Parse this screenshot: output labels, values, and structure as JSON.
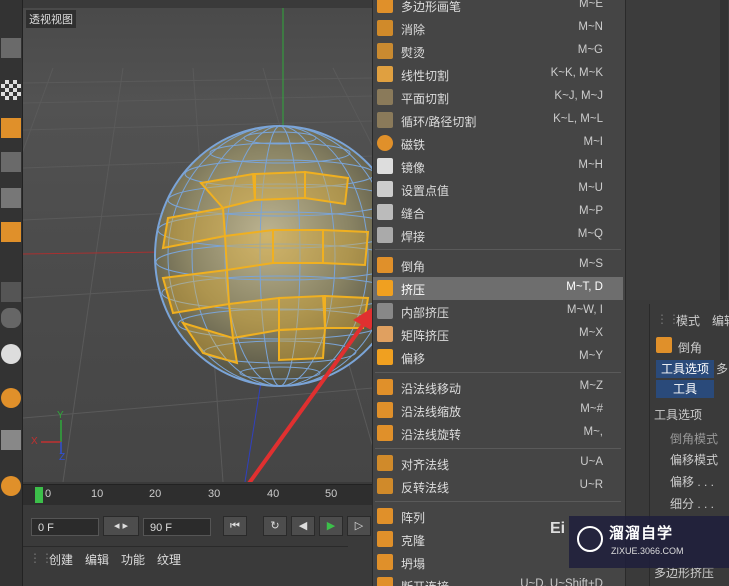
{
  "viewport": {
    "label": "透视视图"
  },
  "timeline": {
    "ticks": [
      "0",
      "10",
      "20",
      "30",
      "40",
      "50"
    ]
  },
  "transport": {
    "current_frame": "0 F",
    "end_frame": "90 F"
  },
  "bottom_menu": {
    "items": [
      "创建",
      "编辑",
      "功能",
      "纹理"
    ]
  },
  "menu": {
    "items": [
      {
        "label": "多边形画笔",
        "shortcut": "M~E"
      },
      {
        "label": "消除",
        "shortcut": "M~N"
      },
      {
        "label": "熨烫",
        "shortcut": "M~G"
      },
      {
        "label": "线性切割",
        "shortcut": "K~K, M~K"
      },
      {
        "label": "平面切割",
        "shortcut": "K~J, M~J"
      },
      {
        "label": "循环/路径切割",
        "shortcut": "K~L, M~L"
      },
      {
        "label": "磁铁",
        "shortcut": "M~I"
      },
      {
        "label": "镜像",
        "shortcut": "M~H"
      },
      {
        "label": "设置点值",
        "shortcut": "M~U"
      },
      {
        "label": "缝合",
        "shortcut": "M~P"
      },
      {
        "label": "焊接",
        "shortcut": "M~Q"
      },
      {
        "label": "倒角",
        "shortcut": "M~S"
      },
      {
        "label": "挤压",
        "shortcut": "M~T, D"
      },
      {
        "label": "内部挤压",
        "shortcut": "M~W, I"
      },
      {
        "label": "矩阵挤压",
        "shortcut": "M~X"
      },
      {
        "label": "偏移",
        "shortcut": "M~Y"
      },
      {
        "label": "沿法线移动",
        "shortcut": "M~Z"
      },
      {
        "label": "沿法线缩放",
        "shortcut": "M~#"
      },
      {
        "label": "沿法线旋转",
        "shortcut": "M~,"
      },
      {
        "label": "对齐法线",
        "shortcut": "U~A"
      },
      {
        "label": "反转法线",
        "shortcut": "U~R"
      },
      {
        "label": "阵列",
        "shortcut": ""
      },
      {
        "label": "克隆",
        "shortcut": ""
      },
      {
        "label": "坍塌",
        "shortcut": ""
      },
      {
        "label": "断开连接",
        "shortcut": "U~D, U~Shift+D"
      }
    ],
    "highlighted": "挤压"
  },
  "attr_panel": {
    "tab_mode": "模式",
    "tab_edit": "编辑",
    "object_name": "倒角",
    "tab_tool_options": "工具选项",
    "tab_more": "多",
    "tab_tool": "工具",
    "section_tool_options": "工具选项",
    "rows": [
      "倒角模式",
      "偏移模式",
      "偏移 . . .",
      "细分 . . ."
    ],
    "footer": "多边形挤压"
  },
  "watermark": {
    "title": "溜溜自学",
    "url": "ZIXUE.3066.COM",
    "side_mark": "Ei"
  },
  "axes": {
    "x": "X",
    "y": "Y",
    "z": "Z"
  },
  "colors": {
    "accent_orange": "#f0a020",
    "highlight": "#6e6e6e",
    "time_cursor": "#3cbf4a",
    "arrow": "#e03030"
  }
}
